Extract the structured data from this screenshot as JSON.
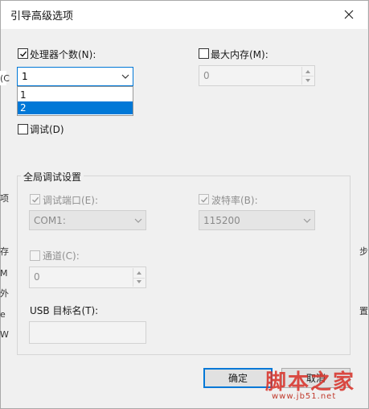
{
  "window": {
    "title": "引导高级选项"
  },
  "processors": {
    "label": "处理器个数(N):",
    "checked": true,
    "selected": "1",
    "options": [
      "1",
      "2"
    ],
    "highlighted": "2"
  },
  "max_memory": {
    "label": "最大内存(M):",
    "checked": false,
    "value": "0"
  },
  "debug": {
    "label": "调试(D)",
    "checked": false
  },
  "global_debug": {
    "title": "全局调试设置",
    "debug_port": {
      "label": "调试端口(E):",
      "checked": true,
      "value": "COM1:"
    },
    "baud_rate": {
      "label": "波特率(B):",
      "checked": true,
      "value": "115200"
    },
    "channel": {
      "label": "通道(C):",
      "checked": false,
      "value": "0"
    },
    "usb_target": {
      "label": "USB 目标名(T):",
      "value": ""
    }
  },
  "buttons": {
    "ok": "确定",
    "cancel": "取消"
  },
  "background_fragments": [
    "(C",
    "项",
    "存",
    "M",
    "外",
    "e",
    "W",
    "步",
    "置"
  ],
  "watermark": {
    "text": "脚本之家",
    "url": "www.jb51.net"
  },
  "colors": {
    "accent": "#0078d7",
    "watermark": "#d9342b"
  }
}
